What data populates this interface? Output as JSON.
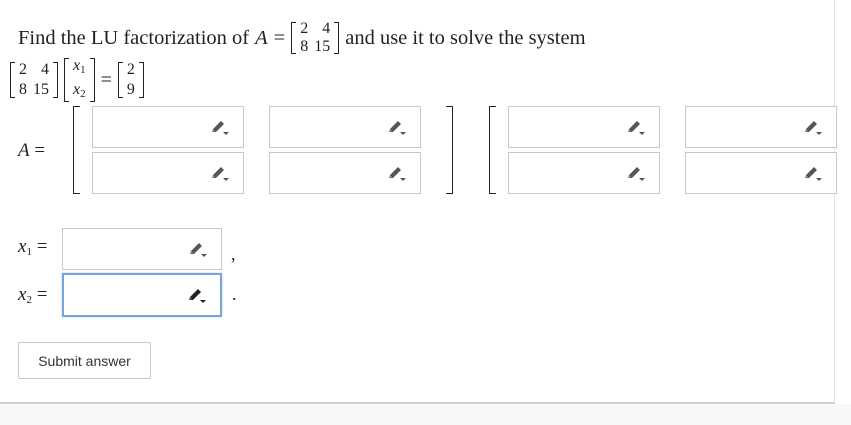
{
  "problem": {
    "intro": "Find the LU factorization of",
    "matrix_symbol": "A",
    "equals": "=",
    "matrix_a": [
      [
        "2",
        "4"
      ],
      [
        "8",
        "15"
      ]
    ],
    "tail": "and use it to solve the system"
  },
  "system": {
    "coeff": [
      [
        "2",
        "4"
      ],
      [
        "8",
        "15"
      ]
    ],
    "vars": [
      {
        "sym": "x",
        "sub": "1"
      },
      {
        "sym": "x",
        "sub": "2"
      }
    ],
    "equals": "=",
    "rhs": [
      "2",
      "9"
    ]
  },
  "lu": {
    "label_symbol": "A",
    "label_equals": "=",
    "l_fields": [
      "",
      "",
      "",
      ""
    ],
    "u_fields": [
      "",
      "",
      "",
      ""
    ]
  },
  "solution": {
    "x1": {
      "sym": "x",
      "sub": "1",
      "equals": "=",
      "value": "",
      "punct": ","
    },
    "x2": {
      "sym": "x",
      "sub": "2",
      "equals": "=",
      "value": "",
      "punct": "."
    }
  },
  "submit_label": "Submit answer",
  "icons": {
    "field_edit": "pencil-icon"
  },
  "colors": {
    "focus_border": "#79a5d6",
    "field_border": "#c8c8c8"
  }
}
